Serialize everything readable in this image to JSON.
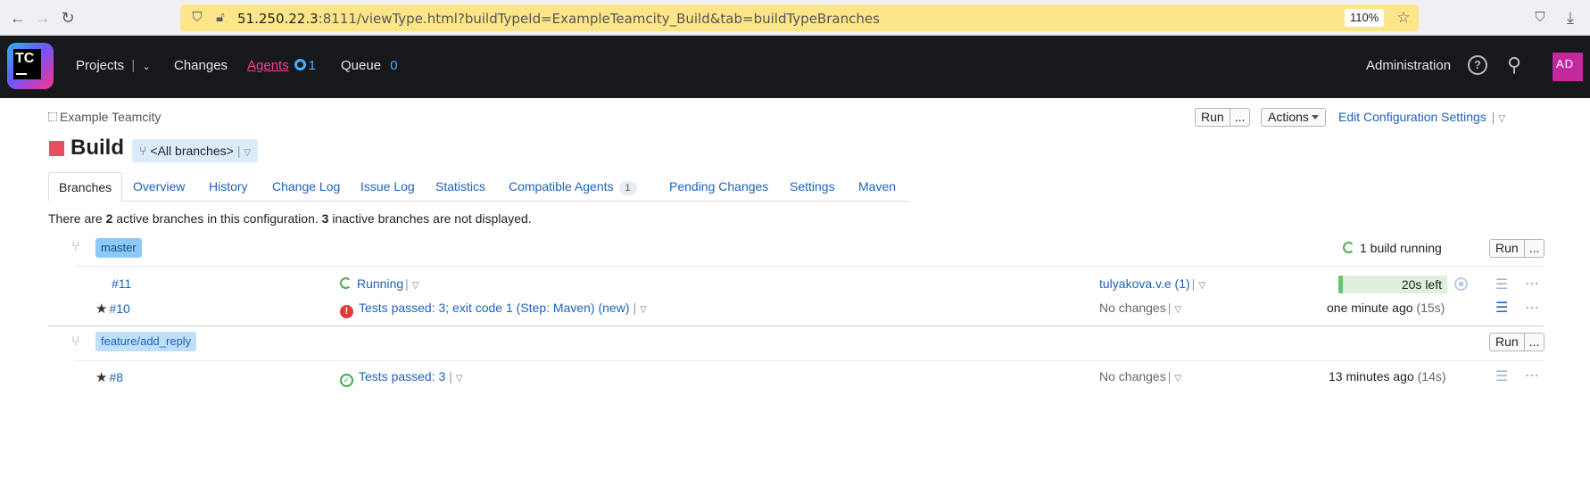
{
  "browser": {
    "url_host": "51.250.22.3",
    "url_rest": ":8111/viewType.html?buildTypeId=ExampleTeamcity_Build&tab=buildTypeBranches",
    "zoom": "110%"
  },
  "header": {
    "logo_text": "TC",
    "nav": {
      "projects": "Projects",
      "changes": "Changes",
      "agents": "Agents",
      "agents_count": "1",
      "queue": "Queue",
      "queue_count": "0"
    },
    "administration": "Administration",
    "help": "?",
    "avatar": "AD"
  },
  "breadcrumb": "Example Teamcity",
  "toolbar": {
    "run": "Run",
    "run_more": "...",
    "actions": "Actions",
    "edit_settings": "Edit Configuration Settings"
  },
  "build_title": "Build",
  "branch_selector": "<All branches>",
  "tabs": [
    {
      "label": "Branches"
    },
    {
      "label": "Overview"
    },
    {
      "label": "History"
    },
    {
      "label": "Change Log"
    },
    {
      "label": "Issue Log"
    },
    {
      "label": "Statistics"
    },
    {
      "label": "Compatible Agents",
      "badge": "1"
    },
    {
      "label": "Pending Changes"
    },
    {
      "label": "Settings"
    },
    {
      "label": "Maven"
    }
  ],
  "summary": {
    "prefix": "There are ",
    "active": "2",
    "mid": " active branches in this configuration. ",
    "inactive": "3",
    "suffix": " inactive branches are not displayed."
  },
  "branches": [
    {
      "name": "master",
      "status": "1 build running",
      "run": "Run",
      "run_more": "...",
      "builds": [
        {
          "number": "#11",
          "result": "Running",
          "changes": "tulyakova.v.e (1)",
          "time": "20s left",
          "progress": 0.0
        },
        {
          "number": "#10",
          "result": "Tests passed: 3; exit code 1 (Step: Maven) (new)",
          "changes": "No changes",
          "time": "one minute ago",
          "duration": "(15s)"
        }
      ]
    },
    {
      "name": "feature/add_reply",
      "run": "Run",
      "run_more": "...",
      "builds": [
        {
          "number": "#8",
          "result": "Tests passed: 3",
          "changes": "No changes",
          "time": "13 minutes ago",
          "duration": "(14s)"
        }
      ]
    }
  ],
  "colors": {
    "header_bg": "#16181c",
    "accent_link": "#1f62b5",
    "active_nav": "#ff3d9a",
    "failed": "#e23a3a",
    "success": "#3ea853",
    "build_square": "#e64e64"
  }
}
